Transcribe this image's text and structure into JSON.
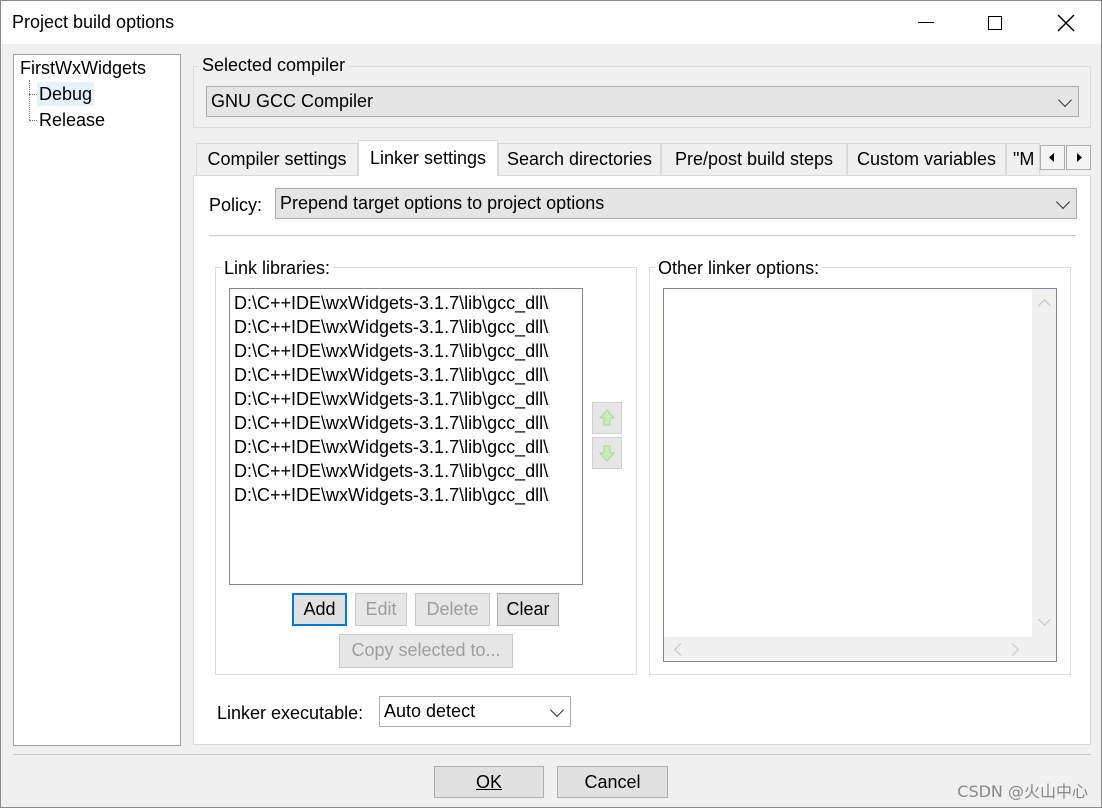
{
  "window": {
    "title": "Project build options"
  },
  "tree": {
    "root": "FirstWxWidgets",
    "targets": [
      "Debug",
      "Release"
    ],
    "selected": "Debug"
  },
  "compiler": {
    "label": "Selected compiler",
    "value": "GNU GCC Compiler"
  },
  "tabs": [
    {
      "label": "Compiler settings",
      "active": false
    },
    {
      "label": "Linker settings",
      "active": true
    },
    {
      "label": "Search directories",
      "active": false
    },
    {
      "label": "Pre/post build steps",
      "active": false
    },
    {
      "label": "Custom variables",
      "active": false
    },
    {
      "label": "\"M",
      "active": false
    }
  ],
  "policy": {
    "label": "Policy:",
    "value": "Prepend target options to project options"
  },
  "link_libraries": {
    "label": "Link libraries:",
    "items": [
      "D:\\C++IDE\\wxWidgets-3.1.7\\lib\\gcc_dll\\",
      "D:\\C++IDE\\wxWidgets-3.1.7\\lib\\gcc_dll\\",
      "D:\\C++IDE\\wxWidgets-3.1.7\\lib\\gcc_dll\\",
      "D:\\C++IDE\\wxWidgets-3.1.7\\lib\\gcc_dll\\",
      "D:\\C++IDE\\wxWidgets-3.1.7\\lib\\gcc_dll\\",
      "D:\\C++IDE\\wxWidgets-3.1.7\\lib\\gcc_dll\\",
      "D:\\C++IDE\\wxWidgets-3.1.7\\lib\\gcc_dll\\",
      "D:\\C++IDE\\wxWidgets-3.1.7\\lib\\gcc_dll\\",
      "D:\\C++IDE\\wxWidgets-3.1.7\\lib\\gcc_dll\\"
    ],
    "buttons": {
      "add": "Add",
      "edit": "Edit",
      "delete": "Delete",
      "clear": "Clear",
      "copy": "Copy selected to..."
    }
  },
  "other_linker": {
    "label": "Other linker options:",
    "value": ""
  },
  "linker_executable": {
    "label": "Linker executable:",
    "value": "Auto detect"
  },
  "footer": {
    "ok": "OK",
    "cancel": "Cancel"
  },
  "watermark": "CSDN @火山中心",
  "icons": {
    "move_up": "up-arrow-icon",
    "move_down": "down-arrow-icon",
    "tab_scroll_left": "triangle-left-icon",
    "tab_scroll_right": "triangle-right-icon"
  }
}
